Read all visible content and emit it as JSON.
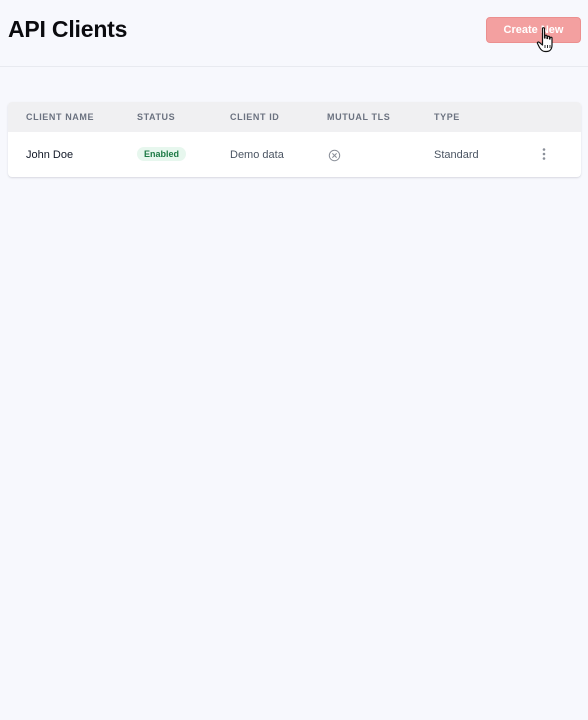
{
  "header": {
    "title": "API Clients",
    "create_button_label": "Create New"
  },
  "table": {
    "columns": [
      "CLIENT NAME",
      "STATUS",
      "CLIENT ID",
      "MUTUAL TLS",
      "TYPE"
    ],
    "rows": [
      {
        "client_name": "John Doe",
        "status": "Enabled",
        "client_id": "Demo data",
        "mutual_tls_icon": "x-circle-icon",
        "type": "Standard"
      }
    ]
  },
  "colors": {
    "primary_button": "#f3a0a0",
    "status_enabled_bg": "#e7f7ee",
    "status_enabled_text": "#1c7a45"
  }
}
